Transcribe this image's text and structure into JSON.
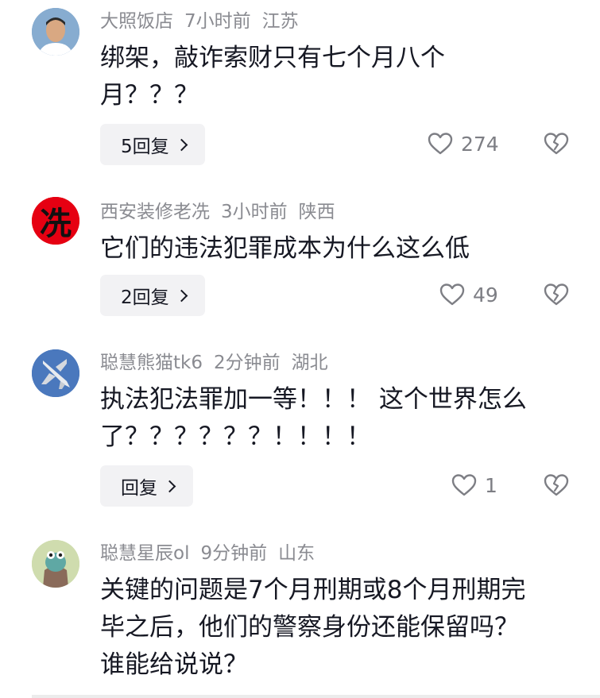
{
  "comments": [
    {
      "username": "大照饭店",
      "time": "7小时前",
      "location": "江苏",
      "text_lines": [
        "绑架，敲诈索财只有七个月八个",
        "月？？？"
      ],
      "reply_label": "5回复",
      "likes": "274",
      "avatar": "photo-avatar-icon"
    },
    {
      "username": "西安装修老冼",
      "time": "3小时前",
      "location": "陕西",
      "text_lines": [
        "它们的违法犯罪成本为什么这么低"
      ],
      "reply_label": "2回复",
      "likes": "49",
      "avatar": "red-circle-logo-icon",
      "avatar_text": "冼"
    },
    {
      "username": "聪慧熊猫tk6",
      "time": "2分钟前",
      "location": "湖北",
      "text_lines": [
        "执法犯法罪加一等！！！ 这个世界怎么",
        "了？？？？？？！！！！"
      ],
      "reply_label": "回复",
      "likes": "1",
      "avatar": "fighter-jet-icon"
    },
    {
      "username": "聪慧星辰ol",
      "time": "9分钟前",
      "location": "山东",
      "text_lines": [
        "关键的问题是7个月刑期或8个月刑期完",
        "毕之后，他们的警察身份还能保留吗？",
        "谁能给说说？"
      ],
      "avatar": "cartoon-avatar-icon"
    }
  ],
  "colors": {
    "meta": "#8a8b91",
    "text": "#161823",
    "reply_bg": "#f2f2f4",
    "icon": "#7d7e84"
  },
  "icons": {
    "like": "heart-outline-icon",
    "dislike": "broken-heart-icon",
    "reply_chevron": "chevron-right-icon"
  }
}
